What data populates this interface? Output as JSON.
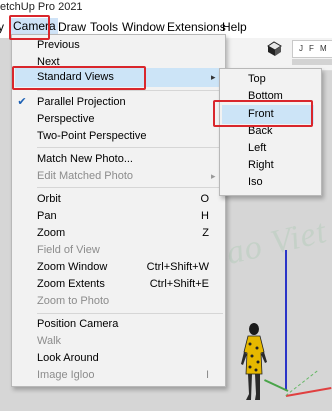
{
  "window": {
    "title": "etchUp Pro 2021"
  },
  "menubar": {
    "left_fragment": "y",
    "items": [
      "Camera",
      "Draw",
      "Tools",
      "Window",
      "Extensions",
      "Help"
    ]
  },
  "toolbar": {
    "months": [
      "J",
      "F",
      "M"
    ]
  },
  "camera_menu": {
    "items": [
      {
        "label": "Previous"
      },
      {
        "label": "Next"
      },
      {
        "label": "Standard Views",
        "submenu": true,
        "highlighted": true
      },
      {
        "label": "Parallel Projection",
        "checked": true
      },
      {
        "label": "Perspective"
      },
      {
        "label": "Two-Point Perspective"
      },
      {
        "label": "Match New Photo..."
      },
      {
        "label": "Edit Matched Photo",
        "disabled": true,
        "submenu": true
      },
      {
        "label": "Orbit",
        "shortcut": "O"
      },
      {
        "label": "Pan",
        "shortcut": "H"
      },
      {
        "label": "Zoom",
        "shortcut": "Z"
      },
      {
        "label": "Field of View",
        "disabled": true
      },
      {
        "label": "Zoom Window",
        "shortcut": "Ctrl+Shift+W"
      },
      {
        "label": "Zoom Extents",
        "shortcut": "Ctrl+Shift+E"
      },
      {
        "label": "Zoom to Photo",
        "disabled": true
      },
      {
        "label": "Position Camera"
      },
      {
        "label": "Walk",
        "disabled": true
      },
      {
        "label": "Look Around"
      },
      {
        "label": "Image Igloo",
        "disabled": true,
        "shortcut": "I"
      }
    ]
  },
  "standard_views": {
    "items": [
      "Top",
      "Bottom",
      "Front",
      "Back",
      "Left",
      "Right",
      "Iso"
    ],
    "selected": "Front"
  },
  "icons": {
    "check": "checkmark-icon",
    "submenu_arrow": "chevron-right-icon"
  },
  "colors": {
    "highlight": "#cce4f7",
    "annotation_red": "#d9262c",
    "axis_blue": "#2b35c8",
    "axis_red": "#e04040",
    "axis_green": "#49a449"
  }
}
